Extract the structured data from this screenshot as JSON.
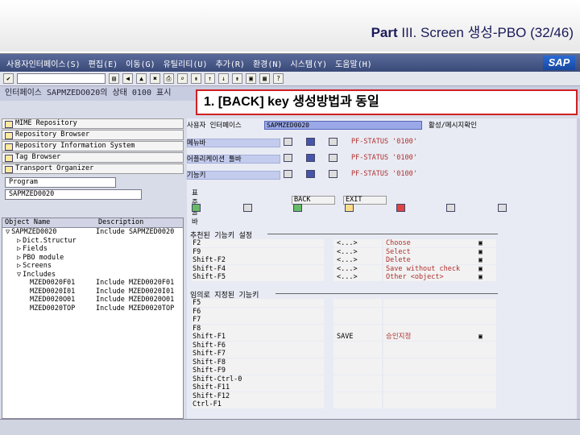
{
  "slide": {
    "title_prefix": "Part",
    "title_rest": " III. Screen 생성-PBO (32/46)"
  },
  "menu": {
    "items": [
      "사용자인터페이스(S)",
      "편집(E)",
      "이동(G)",
      "유틸리티(U)",
      "추가(R)",
      "환경(N)",
      "시스템(Y)",
      "도움말(H)"
    ],
    "logo": "SAP"
  },
  "titlebar": {
    "text": "인터페이스 SAPMZEDO020의 상태 0100 표시"
  },
  "callout": {
    "text": "1. [BACK] key 생성방법과 동일"
  },
  "nav": {
    "buttons": [
      "MIME Repository",
      "Repository Browser",
      "Repository Information System",
      "Tag Browser",
      "Transport Organizer"
    ],
    "object_type": "Program",
    "object_name": "SAPMZED0020"
  },
  "tree": {
    "columns": [
      "Object Name",
      "Description"
    ],
    "rows": [
      {
        "name": "SAPMZED0020",
        "desc": "Include SAPMZED0020",
        "indent": 0,
        "mark": "▽"
      },
      {
        "name": "Dict.Structur",
        "desc": "",
        "indent": 1,
        "mark": "▷"
      },
      {
        "name": "Fields",
        "desc": "",
        "indent": 1,
        "mark": "▷"
      },
      {
        "name": "PBO module",
        "desc": "",
        "indent": 1,
        "mark": "▷"
      },
      {
        "name": "Screens",
        "desc": "",
        "indent": 1,
        "mark": "▷"
      },
      {
        "name": "Includes",
        "desc": "",
        "indent": 1,
        "mark": "▽"
      },
      {
        "name": "MZED0020F01",
        "desc": "Include MZED0020F01",
        "indent": 2,
        "mark": ""
      },
      {
        "name": "MZED0020I01",
        "desc": "Include MZED0020I01",
        "indent": 2,
        "mark": ""
      },
      {
        "name": "MZED0020O01",
        "desc": "Include MZED0020O01",
        "indent": 2,
        "mark": ""
      },
      {
        "name": "MZED0020TOP",
        "desc": "Include MZED0020TOP",
        "indent": 2,
        "mark": ""
      }
    ]
  },
  "interface": {
    "user_interface_label": "사용자 인터페이스",
    "program_name": "SAPMZED0020",
    "active_label": "활성/메시지확인",
    "rows": [
      {
        "label": "메뉴바",
        "status": "PF-STATUS '0100'"
      },
      {
        "label": "어플리케이션 툴바",
        "status": "PF-STATUS '0100'"
      },
      {
        "label": "기능키",
        "status": "PF-STATUS '0100'"
      }
    ],
    "std_toolbar_label": "표준툴바",
    "back_code": "BACK",
    "exit_code": "EXIT"
  },
  "recommended": {
    "title": "추천된 기능키 설정",
    "rows": [
      {
        "key": "F2",
        "code": "<...>",
        "text": "Choose"
      },
      {
        "key": "F9",
        "code": "<...>",
        "text": "Select"
      },
      {
        "key": "Shift-F2",
        "code": "<...>",
        "text": "Delete"
      },
      {
        "key": "Shift-F4",
        "code": "<...>",
        "text": "Save without check"
      },
      {
        "key": "Shift-F5",
        "code": "<...>",
        "text": "Other <object>"
      }
    ]
  },
  "free": {
    "title": "임의로 지정된 기능키",
    "rows": [
      {
        "key": "F5",
        "code": "",
        "text": ""
      },
      {
        "key": "F6",
        "code": "",
        "text": ""
      },
      {
        "key": "F7",
        "code": "",
        "text": ""
      },
      {
        "key": "F8",
        "code": "",
        "text": ""
      },
      {
        "key": "Shift-F1",
        "code": "SAVE",
        "text": "승인지정"
      },
      {
        "key": "Shift-F6",
        "code": "",
        "text": ""
      },
      {
        "key": "Shift-F7",
        "code": "",
        "text": ""
      },
      {
        "key": "Shift-F8",
        "code": "",
        "text": ""
      },
      {
        "key": "Shift-F9",
        "code": "",
        "text": ""
      },
      {
        "key": "Shift-Ctrl-0",
        "code": "",
        "text": ""
      },
      {
        "key": "Shift-F11",
        "code": "",
        "text": ""
      },
      {
        "key": "Shift-F12",
        "code": "",
        "text": ""
      },
      {
        "key": "Ctrl-F1",
        "code": "",
        "text": ""
      }
    ]
  }
}
